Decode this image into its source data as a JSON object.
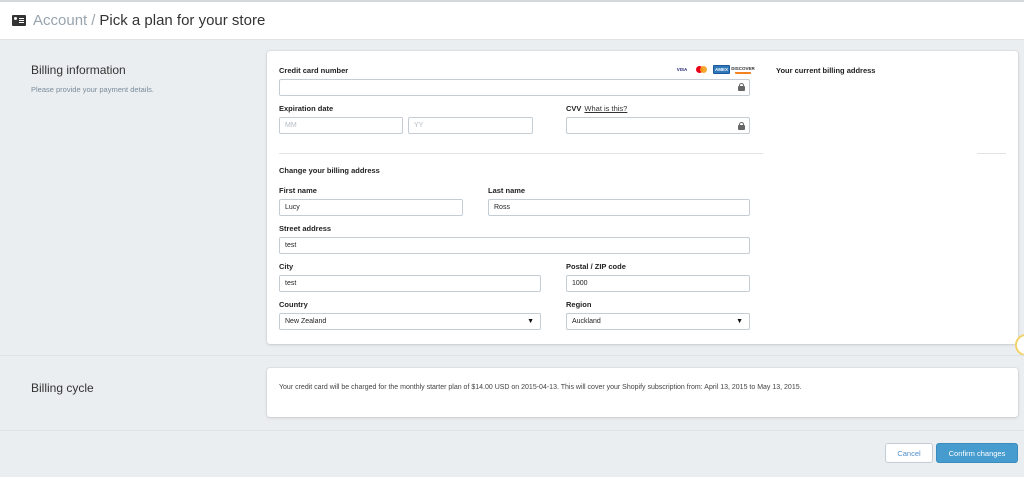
{
  "header": {
    "breadcrumb_link": "Account",
    "breadcrumb_separator": "/",
    "title": "Pick a plan for your store",
    "icon": "id-card-icon"
  },
  "billing_info": {
    "title": "Billing information",
    "description": "Please provide your payment details."
  },
  "payment": {
    "card_number_label": "Credit card number",
    "card_number_value": "",
    "card_brands": [
      "VISA",
      "MasterCard",
      "AMEX",
      "DISCOVER"
    ],
    "expiration_label": "Expiration date",
    "month_placeholder": "MM",
    "year_placeholder": "YY",
    "cvv_label": "CVV",
    "cvv_help": "What is this?",
    "cvv_value": ""
  },
  "address": {
    "heading": "Change your billing address",
    "first_name_label": "First name",
    "first_name": "Lucy",
    "last_name_label": "Last name",
    "last_name": "Ross",
    "street_label": "Street address",
    "street": "test",
    "city_label": "City",
    "city": "test",
    "postal_label": "Postal / ZIP code",
    "postal": "1000",
    "country_label": "Country",
    "country": "New Zealand",
    "region_label": "Region",
    "region": "Auckland"
  },
  "current_address": {
    "title": "Your current billing address"
  },
  "billing_cycle": {
    "title": "Billing cycle",
    "message": "Your credit card will be charged for the monthly starter plan of $14.00 USD on 2015-04-13. This will cover your Shopify subscription from: April 13, 2015 to May 13, 2015."
  },
  "actions": {
    "cancel": "Cancel",
    "confirm": "Confirm changes"
  },
  "colors": {
    "accent": "#479ccf",
    "background": "#ebeef0"
  }
}
